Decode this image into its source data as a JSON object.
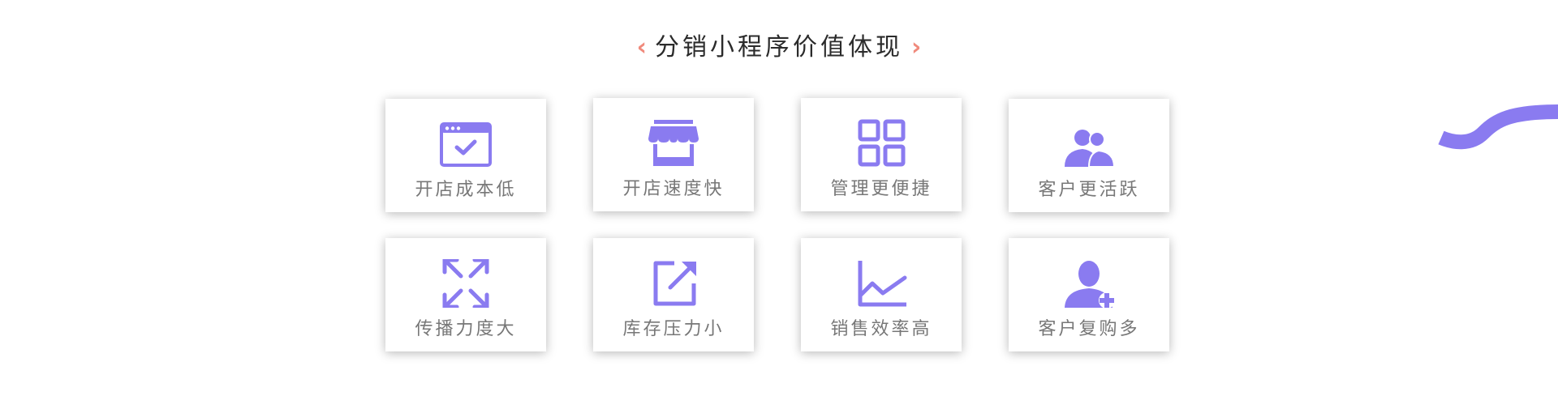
{
  "title": {
    "left_chevron": "‹",
    "text": "分销小程序价值体现",
    "right_chevron": "›"
  },
  "colors": {
    "accent": "#8a7bf0",
    "chevron": "#f08a7c",
    "title_text": "#2b2b2b",
    "label_text": "#777777"
  },
  "features": [
    {
      "label": "开店成本低",
      "icon": "browser-check-icon"
    },
    {
      "label": "开店速度快",
      "icon": "storefront-icon"
    },
    {
      "label": "管理更便捷",
      "icon": "grid-icon"
    },
    {
      "label": "客户更活跃",
      "icon": "users-icon"
    },
    {
      "label": "传播力度大",
      "icon": "expand-icon"
    },
    {
      "label": "库存压力小",
      "icon": "external-link-icon"
    },
    {
      "label": "销售效率高",
      "icon": "line-chart-icon"
    },
    {
      "label": "客户复购多",
      "icon": "add-user-icon"
    }
  ]
}
